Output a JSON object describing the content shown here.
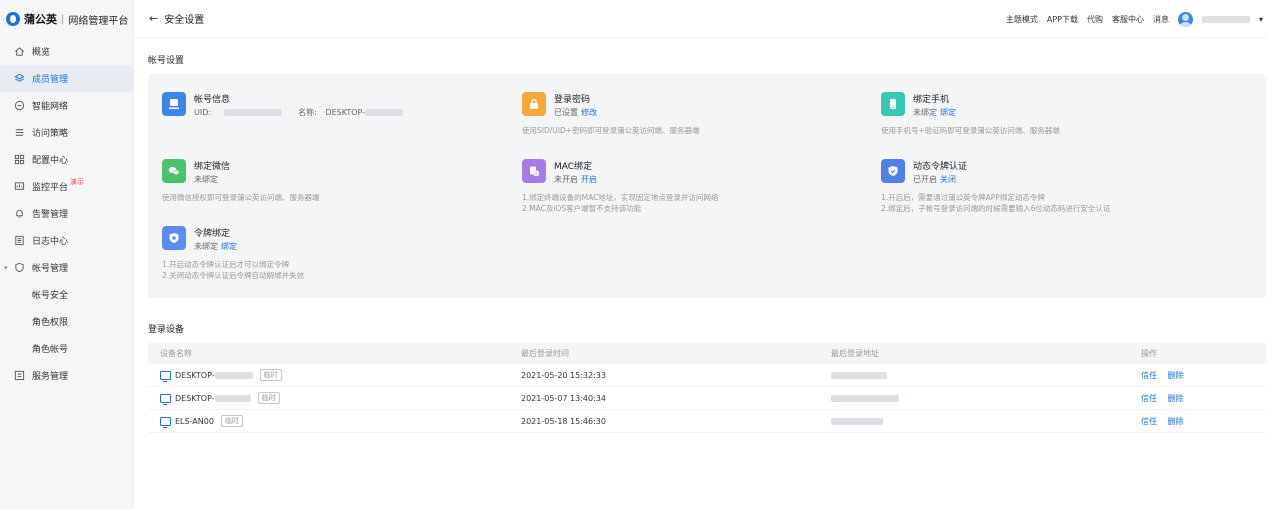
{
  "brand": {
    "name": "蒲公英",
    "separator": "|",
    "subtitle": "网络管理平台"
  },
  "sidebar": {
    "items": [
      {
        "label": "概览",
        "icon": "home-icon"
      },
      {
        "label": "成员管理",
        "icon": "layers-icon",
        "active": true
      },
      {
        "label": "智能网络",
        "icon": "network-icon"
      },
      {
        "label": "访问策略",
        "icon": "policy-icon"
      },
      {
        "label": "配置中心",
        "icon": "grid-icon"
      },
      {
        "label": "监控平台",
        "icon": "monitor-icon",
        "badge": "演示"
      },
      {
        "label": "告警管理",
        "icon": "bell-icon"
      },
      {
        "label": "日志中心",
        "icon": "log-icon"
      },
      {
        "label": "帐号管理",
        "icon": "shield-icon",
        "expanded": true
      },
      {
        "label": "帐号安全",
        "sub": true
      },
      {
        "label": "角色权限",
        "sub": true
      },
      {
        "label": "角色帐号",
        "sub": true
      },
      {
        "label": "服务管理",
        "icon": "service-icon"
      }
    ]
  },
  "header": {
    "back": "←",
    "title": "安全设置",
    "links": [
      "主题模式",
      "APP下载",
      "代购",
      "客服中心",
      "消息"
    ],
    "dropdown": "▾"
  },
  "account_settings": {
    "title": "帐号设置",
    "cards": [
      {
        "key": "account",
        "title": "帐号信息",
        "status_label": "UID:",
        "status_label2": "名称:",
        "status_value2": "DESKTOP-",
        "desc": [],
        "color": "#3a86ec"
      },
      {
        "key": "password",
        "title": "登录密码",
        "status_label": "已设置",
        "link": "修改",
        "desc": [
          "使用SID/UID+密码即可登录蒲公英访问端、服务器端"
        ],
        "color": "#f2a93b"
      },
      {
        "key": "phone",
        "title": "绑定手机",
        "status_label": "未绑定",
        "link": "绑定",
        "desc": [
          "使用手机号+验证码即可登录蒲公英访问端、服务器端"
        ],
        "color": "#3cc7b4"
      },
      {
        "key": "wechat",
        "title": "绑定微信",
        "status_label": "未绑定",
        "desc": [
          "使用微信授权即可登录蒲公英访问端、服务器端"
        ],
        "color": "#4cc26a"
      },
      {
        "key": "mac",
        "title": "MAC绑定",
        "status_label": "未开启",
        "link": "开启",
        "desc": [
          "1.绑定终端设备的MAC地址，实现固定地点登录并访问网络",
          "2.MAC及iOS客户端暂不支持该功能"
        ],
        "color": "#a77be6"
      },
      {
        "key": "otp",
        "title": "动态令牌认证",
        "status_label": "已开启",
        "link": "关闭",
        "desc": [
          "1.开启后，需要通过蒲公英令牌APP绑定动态令牌",
          "2.绑定后，子帐号登录访问端的时候需要输入6位动态码进行安全认证"
        ],
        "color": "#4f7fe8"
      },
      {
        "key": "token",
        "title": "令牌绑定",
        "status_label": "未绑定",
        "link": "绑定",
        "desc": [
          "1.开启动态令牌认证后才可以绑定令牌",
          "2.关闭动态令牌认证后令牌自动解绑并失效"
        ],
        "color": "#5b8cf0"
      }
    ]
  },
  "login_devices": {
    "title": "登录设备",
    "columns": [
      "设备名称",
      "最后登录时间",
      "最后登录地址",
      "操作"
    ],
    "rows": [
      {
        "name": "DESKTOP-",
        "tag": "临时",
        "time": "2021-05-20 15:32:33",
        "actions": [
          "信任",
          "删除"
        ]
      },
      {
        "name": "DESKTOP-",
        "tag": "临时",
        "time": "2021-05-07 13:40:34",
        "actions": [
          "信任",
          "删除"
        ]
      },
      {
        "name": "ELS-AN00",
        "tag": "临时",
        "time": "2021-05-18 15:46:30",
        "actions": [
          "信任",
          "删除"
        ]
      }
    ]
  },
  "colors": {
    "accent": "#1e6fe6",
    "sidebar_bg": "#f5f6f8",
    "panel_bg": "#f4f5f7"
  }
}
